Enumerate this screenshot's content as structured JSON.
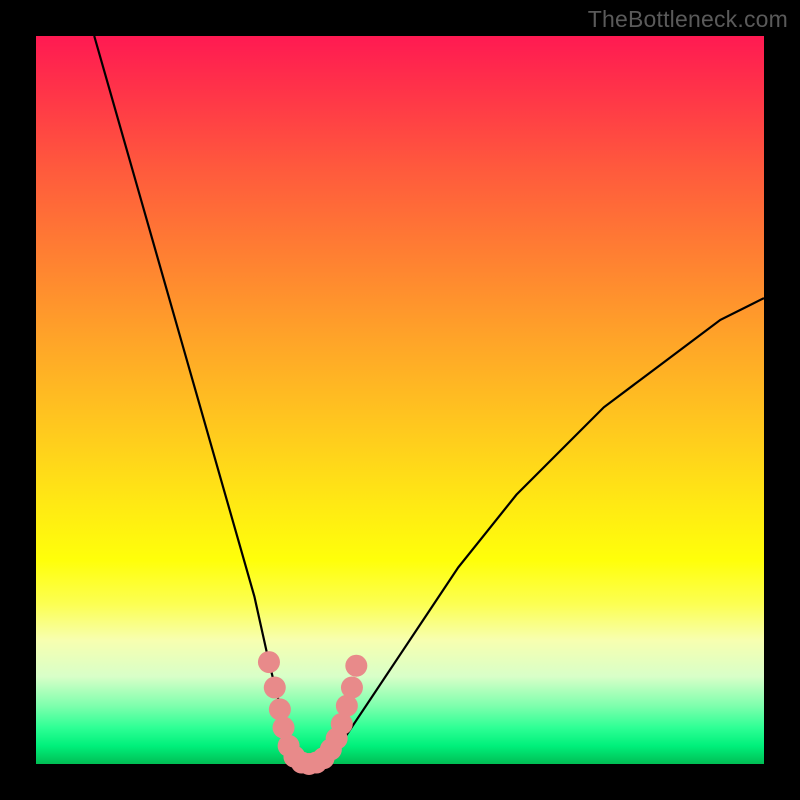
{
  "watermark": "TheBottleneck.com",
  "chart_data": {
    "type": "line",
    "title": "",
    "xlabel": "",
    "ylabel": "",
    "xlim": [
      0,
      100
    ],
    "ylim": [
      0,
      100
    ],
    "grid": false,
    "series": [
      {
        "name": "bottleneck-curve",
        "color": "#000000",
        "x": [
          8,
          10,
          12,
          14,
          16,
          18,
          20,
          22,
          24,
          26,
          28,
          30,
          32,
          33,
          34,
          35,
          36,
          37,
          38,
          39,
          40,
          42,
          44,
          46,
          48,
          50,
          54,
          58,
          62,
          66,
          70,
          74,
          78,
          82,
          86,
          90,
          94,
          98,
          100
        ],
        "y": [
          100,
          93,
          86,
          79,
          72,
          65,
          58,
          51,
          44,
          37,
          30,
          23,
          14,
          10,
          6,
          3,
          1,
          0,
          0,
          0,
          1,
          3,
          6,
          9,
          12,
          15,
          21,
          27,
          32,
          37,
          41,
          45,
          49,
          52,
          55,
          58,
          61,
          63,
          64
        ]
      }
    ],
    "markers": {
      "name": "highlight-dots",
      "color": "#e88a8a",
      "points": [
        {
          "x": 32.0,
          "y": 14.0
        },
        {
          "x": 32.8,
          "y": 10.5
        },
        {
          "x": 33.5,
          "y": 7.5
        },
        {
          "x": 34.0,
          "y": 5.0
        },
        {
          "x": 34.7,
          "y": 2.5
        },
        {
          "x": 35.5,
          "y": 1.0
        },
        {
          "x": 36.5,
          "y": 0.2
        },
        {
          "x": 37.5,
          "y": 0.0
        },
        {
          "x": 38.5,
          "y": 0.2
        },
        {
          "x": 39.5,
          "y": 0.8
        },
        {
          "x": 40.5,
          "y": 2.0
        },
        {
          "x": 41.3,
          "y": 3.5
        },
        {
          "x": 42.0,
          "y": 5.5
        },
        {
          "x": 42.7,
          "y": 8.0
        },
        {
          "x": 43.4,
          "y": 10.5
        },
        {
          "x": 44.0,
          "y": 13.5
        }
      ]
    },
    "background_gradient": {
      "top": "#ff1a52",
      "mid_upper": "#ffa528",
      "mid": "#ffff0a",
      "mid_lower": "#d8ffc8",
      "bottom": "#00be54"
    }
  }
}
